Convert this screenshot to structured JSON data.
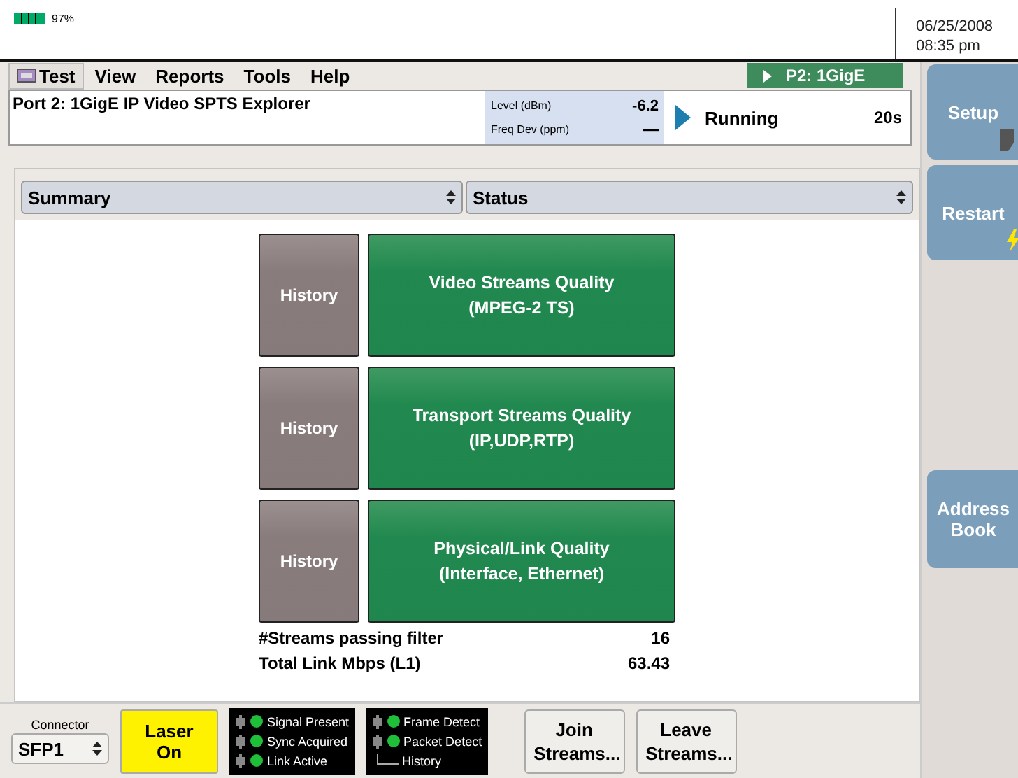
{
  "status_bar": {
    "battery": "97%",
    "date": "06/25/2008",
    "time": "08:35 pm"
  },
  "menu": [
    {
      "label": "Test",
      "kind": "icon",
      "selected": true
    },
    {
      "label": "View",
      "kind": "plain",
      "selected": false
    },
    {
      "label": "Reports",
      "kind": "plain",
      "selected": false
    },
    {
      "label": "Tools",
      "kind": "plain",
      "selected": false
    },
    {
      "label": "Help",
      "kind": "plain",
      "selected": false
    }
  ],
  "port_badge": "P2: 1GigE",
  "info": {
    "title": "Port 2: 1GigE IP Video SPTS Explorer",
    "readings": [
      {
        "label": "Level (dBm)",
        "value": "-6.2"
      },
      {
        "label": "Freq Dev (ppm)",
        "value": "—"
      }
    ],
    "state": "Running",
    "elapsed": "20s"
  },
  "selectors": [
    "Summary",
    "Status"
  ],
  "quality_rows": [
    {
      "history": "History",
      "title": "Video Streams Quality",
      "subtitle": "(MPEG-2 TS)"
    },
    {
      "history": "History",
      "title": "Transport Streams Quality",
      "subtitle": "(IP,UDP,RTP)"
    },
    {
      "history": "History",
      "title": "Physical/Link Quality",
      "subtitle": "(Interface, Ethernet)"
    }
  ],
  "stats": [
    {
      "label": "#Streams passing filter",
      "value": "16"
    },
    {
      "label": "Total Link Mbps (L1)",
      "value": "63.43"
    }
  ],
  "side_buttons": [
    {
      "label": "Setup"
    },
    {
      "label": "Restart"
    },
    {
      "label": "Address Book"
    }
  ],
  "connector": {
    "label": "Connector",
    "value": "SFP1"
  },
  "laser": {
    "label": "Laser On",
    "on": true
  },
  "leds": [
    [
      {
        "label": "Signal Present",
        "on": true
      },
      {
        "label": "Sync Acquired",
        "on": true
      },
      {
        "label": "Link Active",
        "on": true
      }
    ],
    [
      {
        "label": "Frame Detect",
        "on": true
      },
      {
        "label": "Packet Detect",
        "on": true
      },
      {
        "label": "History",
        "kind": "history"
      }
    ]
  ],
  "actions": [
    "Join Streams...",
    "Leave Streams..."
  ]
}
